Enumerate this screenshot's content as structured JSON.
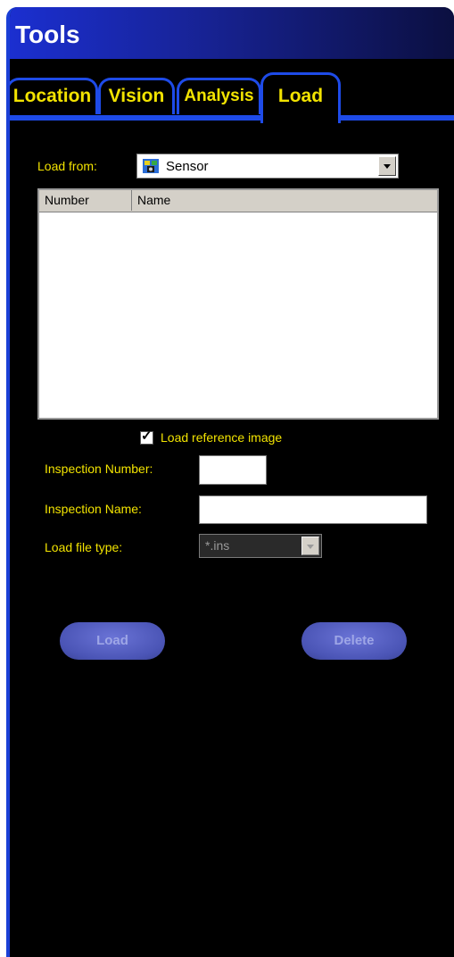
{
  "window": {
    "title": "Tools"
  },
  "tabs": [
    {
      "label": "Location",
      "active": false
    },
    {
      "label": "Vision",
      "active": false
    },
    {
      "label": "Analysis",
      "active": false
    },
    {
      "label": "Load",
      "active": true
    }
  ],
  "load_from": {
    "label": "Load from:",
    "value": "Sensor",
    "icon": "sensor-icon"
  },
  "list": {
    "columns": [
      "Number",
      "Name"
    ],
    "rows": []
  },
  "load_reference_image": {
    "label": "Load reference image",
    "checked": true
  },
  "inspection_number": {
    "label": "Inspection Number:",
    "value": ""
  },
  "inspection_name": {
    "label": "Inspection Name:",
    "value": ""
  },
  "load_file_type": {
    "label": "Load file type:",
    "value": "*.ins",
    "enabled": false
  },
  "buttons": {
    "load": "Load",
    "delete": "Delete"
  },
  "colors": {
    "accent": "#1e4be8",
    "label_text": "#f2e300",
    "background": "#000000",
    "button": "#4b55b6"
  }
}
